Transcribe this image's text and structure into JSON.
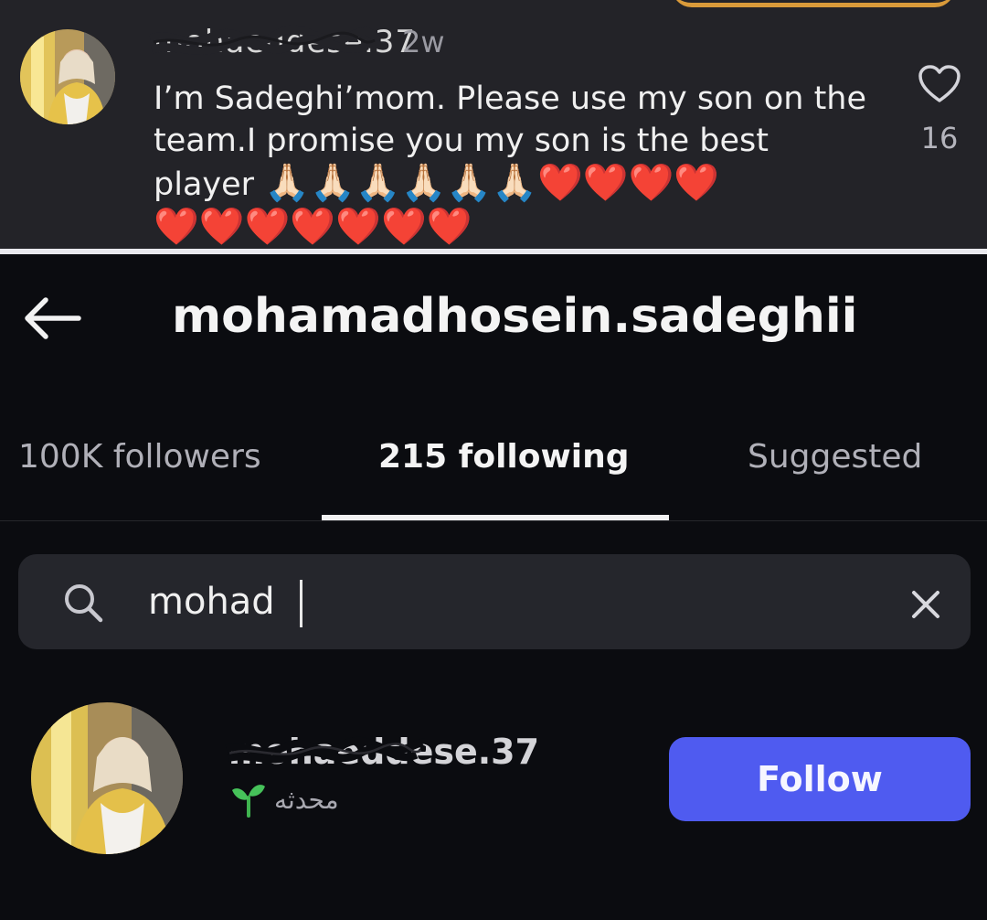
{
  "comment": {
    "username": "mohaeddese.37",
    "time": "2w",
    "text": "I’m Sadeghi’mom. Please use my son on the team.I promise you my son is the best player",
    "emoji_line1": "🙏🏻🙏🏻🙏🏻🙏🏻🙏🏻🙏🏻❤️❤️❤️❤️",
    "emoji_line2": "❤️❤️❤️❤️❤️❤️❤️",
    "like_count": "16",
    "avatar_icon": "profile-photo",
    "like_icon": "heart-outline-icon"
  },
  "header": {
    "title": "mohamadhosein.sadeghii",
    "back_icon": "arrow-left-icon"
  },
  "tabs": [
    {
      "label": "100K followers",
      "active": false
    },
    {
      "label": "215 following",
      "active": true
    },
    {
      "label": "Suggested",
      "active": false
    }
  ],
  "search": {
    "value": "mohad",
    "search_icon": "search-icon",
    "clear_icon": "close-icon"
  },
  "result": {
    "username": "mohaeddese.37",
    "subtitle": "محدثه",
    "sub_icon": "sprout-icon",
    "follow_label": "Follow",
    "follow_color": "#4f5bf0"
  },
  "colors": {
    "background": "#0b0c10",
    "comment_panel": "#232328",
    "search_box": "#25262c"
  }
}
